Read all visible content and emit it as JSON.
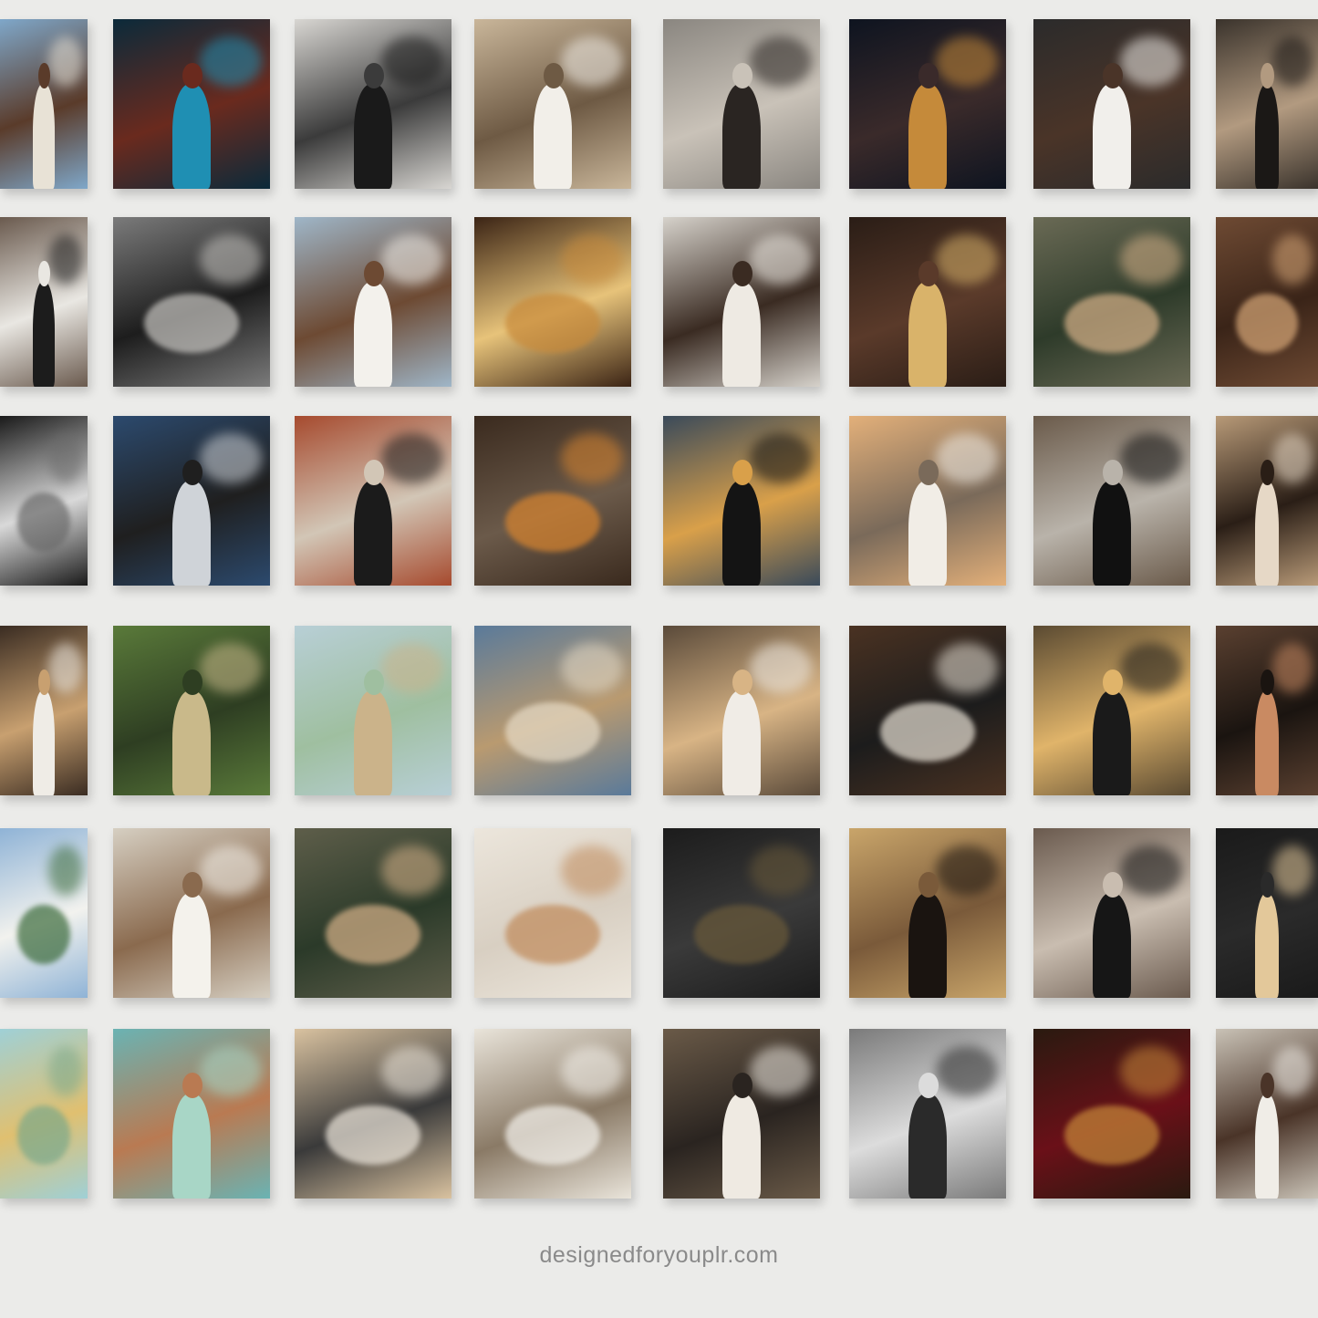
{
  "footer": {
    "site": "designedforyouplr.com"
  },
  "tiles": [
    {
      "subject": "man-white-shirt-outdoors",
      "palette": [
        "#7fa7c9",
        "#e8e2d6",
        "#5a3b2a"
      ],
      "figure": true
    },
    {
      "subject": "boutique-storefront-night",
      "palette": [
        "#0b2a3a",
        "#1f8fb3",
        "#6a2a1e"
      ],
      "figure": true
    },
    {
      "subject": "man-black-suit-car",
      "palette": [
        "#d8d6d2",
        "#1a1a1a",
        "#3b3b3b"
      ],
      "figure": true
    },
    {
      "subject": "man-white-shirt-city",
      "palette": [
        "#c9b69a",
        "#f2efe9",
        "#6e5a44"
      ],
      "figure": true
    },
    {
      "subject": "woman-cap-cardigan",
      "palette": [
        "#8a8680",
        "#2a2522",
        "#c9c2b8"
      ],
      "figure": true
    },
    {
      "subject": "woman-night-city-window",
      "palette": [
        "#0e1420",
        "#c58a3a",
        "#3a2a2a"
      ],
      "figure": true
    },
    {
      "subject": "woman-white-blazer-jet",
      "palette": [
        "#2b2b2b",
        "#f1efeb",
        "#4a3428"
      ],
      "figure": true
    },
    {
      "subject": "woman-black-blazer-doorway",
      "palette": [
        "#3a332c",
        "#1b1816",
        "#b29a80"
      ],
      "figure": true
    },
    {
      "subject": "man-elevator-selfie",
      "palette": [
        "#6a5a4e",
        "#1c1c1c",
        "#e9e7e2"
      ],
      "figure": true
    },
    {
      "subject": "marble-desk-sunglasses",
      "palette": [
        "#7b7b7b",
        "#c8c6c2",
        "#1d1d1d"
      ],
      "figure": false
    },
    {
      "subject": "man-white-suit-yacht",
      "palette": [
        "#9fb6c8",
        "#f3f1ec",
        "#6d4a33"
      ],
      "figure": true
    },
    {
      "subject": "whiskey-glass-bar",
      "palette": [
        "#3b2415",
        "#c88a3a",
        "#e7c37a"
      ],
      "figure": false
    },
    {
      "subject": "woman-beige-suit-column",
      "palette": [
        "#d6d2cb",
        "#eeeae3",
        "#3a2b22"
      ],
      "figure": true
    },
    {
      "subject": "woman-champagne-glass",
      "palette": [
        "#2a1d16",
        "#d9b36a",
        "#5a3a2a"
      ],
      "figure": true
    },
    {
      "subject": "round-window-palm-sunset",
      "palette": [
        "#6a6a55",
        "#d7b289",
        "#2e3b2a"
      ],
      "figure": false
    },
    {
      "subject": "hand-rings-light",
      "palette": [
        "#6e4a33",
        "#d8a878",
        "#3a2418"
      ],
      "figure": false
    },
    {
      "subject": "car-interior-black",
      "palette": [
        "#1a1a1a",
        "#6a6a6a",
        "#d9d9d9"
      ],
      "figure": false
    },
    {
      "subject": "man-blue-blazer",
      "palette": [
        "#2c4a6e",
        "#cfd3d8",
        "#1f1f1f"
      ],
      "figure": true
    },
    {
      "subject": "man-black-suit-jeep",
      "palette": [
        "#a64a2e",
        "#1b1b1b",
        "#d2c6b6"
      ],
      "figure": true
    },
    {
      "subject": "desk-setup-computer",
      "palette": [
        "#3a2a1e",
        "#d9852f",
        "#6b5a4a"
      ],
      "figure": false
    },
    {
      "subject": "woman-black-trench-street",
      "palette": [
        "#3a4a5a",
        "#141414",
        "#d9a04a"
      ],
      "figure": true
    },
    {
      "subject": "woman-bed-sunset-sea",
      "palette": [
        "#e3b07a",
        "#f1ede6",
        "#7a6a5a"
      ],
      "figure": true
    },
    {
      "subject": "woman-black-crop-top-city",
      "palette": [
        "#6a5a4a",
        "#111111",
        "#b9b3aa"
      ],
      "figure": true
    },
    {
      "subject": "woman-car-coffee",
      "palette": [
        "#b89a78",
        "#e6d8c6",
        "#2a1e16"
      ],
      "figure": true
    },
    {
      "subject": "woman-white-blazer-back",
      "palette": [
        "#3a2c22",
        "#efece6",
        "#c8a070"
      ],
      "figure": true
    },
    {
      "subject": "mother-child-garden",
      "palette": [
        "#5a7a3a",
        "#c9b98a",
        "#2e3e22"
      ],
      "figure": true
    },
    {
      "subject": "woman-desert-hat",
      "palette": [
        "#b8cfd6",
        "#cbb38a",
        "#9fbfa0"
      ],
      "figure": true
    },
    {
      "subject": "bedroom-blue-wall",
      "palette": [
        "#5a7a9a",
        "#e7dcc8",
        "#b99a70"
      ],
      "figure": false
    },
    {
      "subject": "woman-blonde-white-jacket",
      "palette": [
        "#5a4a3a",
        "#f0ece6",
        "#d8b485"
      ],
      "figure": true
    },
    {
      "subject": "cafe-bag-coffee",
      "palette": [
        "#4a3222",
        "#e9e2d6",
        "#1c1c1c"
      ],
      "figure": false
    },
    {
      "subject": "woman-black-dress-window",
      "palette": [
        "#5a4a32",
        "#1a1a1a",
        "#e0b46a"
      ],
      "figure": true
    },
    {
      "subject": "woman-hand-on-face",
      "palette": [
        "#5a4030",
        "#c98a62",
        "#1a1410"
      ],
      "figure": true
    },
    {
      "subject": "mountain-meadow-flowers",
      "palette": [
        "#8fb3d6",
        "#3a6a3a",
        "#f2f2ee"
      ],
      "figure": false
    },
    {
      "subject": "woman-white-dress-wall",
      "palette": [
        "#d6cfc2",
        "#f4f2ec",
        "#8a6a4e"
      ],
      "figure": true
    },
    {
      "subject": "round-window-palm-sunset-2",
      "palette": [
        "#5e5e4a",
        "#d8b38a",
        "#2b3a29"
      ],
      "figure": false
    },
    {
      "subject": "dog-on-sofa",
      "palette": [
        "#ece6dc",
        "#c08a5a",
        "#d8cfc2"
      ],
      "figure": false
    },
    {
      "subject": "dark-living-room",
      "palette": [
        "#1c1c1c",
        "#6a5a3a",
        "#3a3a3a"
      ],
      "figure": false
    },
    {
      "subject": "woman-silhouette-curtain",
      "palette": [
        "#c9a56a",
        "#1a1410",
        "#7a5a3a"
      ],
      "figure": true
    },
    {
      "subject": "woman-black-outfit-street",
      "palette": [
        "#6a5a4e",
        "#161616",
        "#c9bdb0"
      ],
      "figure": true
    },
    {
      "subject": "woman-blonde-black-jacket",
      "palette": [
        "#1a1a1a",
        "#e3c89a",
        "#2a2a2a"
      ],
      "figure": true
    },
    {
      "subject": "cactus-sky",
      "palette": [
        "#9fd0d6",
        "#7aa88a",
        "#e0c070"
      ],
      "figure": false
    },
    {
      "subject": "woman-teal-swimsuit-hat",
      "palette": [
        "#6ab3b3",
        "#a8d6c6",
        "#b97a52"
      ],
      "figure": true
    },
    {
      "subject": "desk-computer-candle",
      "palette": [
        "#d9c2a0",
        "#f0e9de",
        "#3a3a3a"
      ],
      "figure": false
    },
    {
      "subject": "book-white-flowers",
      "palette": [
        "#e9e4da",
        "#f6f4ef",
        "#8a7a66"
      ],
      "figure": false
    },
    {
      "subject": "woman-white-suit-cap",
      "palette": [
        "#6a5a48",
        "#efeae2",
        "#2a2420"
      ],
      "figure": true
    },
    {
      "subject": "woman-bw-window",
      "palette": [
        "#7a7a7a",
        "#2a2a2a",
        "#dcdcdc"
      ],
      "figure": true
    },
    {
      "subject": "laptop-red-wine",
      "palette": [
        "#2a1a10",
        "#c88a3a",
        "#6a1018"
      ],
      "figure": false
    },
    {
      "subject": "woman-white-shirt-earring",
      "palette": [
        "#c9c2b6",
        "#f0ede7",
        "#4a3428"
      ],
      "figure": true
    }
  ]
}
